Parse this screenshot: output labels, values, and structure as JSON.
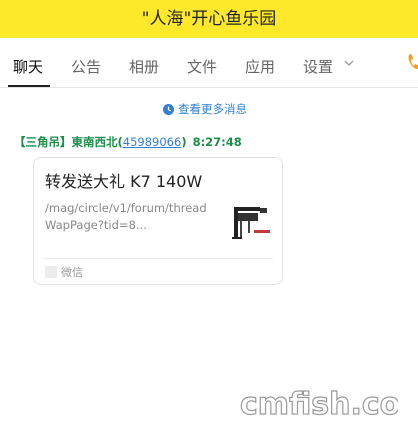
{
  "window": {
    "title": "\"人海\"开心鱼乐园"
  },
  "tabs": [
    {
      "label": "聊天",
      "active": true
    },
    {
      "label": "公告"
    },
    {
      "label": "相册"
    },
    {
      "label": "文件"
    },
    {
      "label": "应用"
    },
    {
      "label": "设置"
    }
  ],
  "messages": {
    "more_history": "查看更多消息",
    "sender_group_tag": "【三角吊】",
    "sender_name": "東南西北",
    "sender_uid": "45989066",
    "sender_time": "8:27:48"
  },
  "card": {
    "title": "转发送大礼 K7 140W",
    "description": "/mag/circle/v1/forum/threadWapPage?tid=8...",
    "source": "微信"
  },
  "watermark": {
    "text": "cmfish.com"
  },
  "colors": {
    "title_bar": "#fde82a",
    "link_blue": "#2f7fd8",
    "sender_green": "#1c8d4a",
    "phone_orange": "#f0a020"
  },
  "icons": {
    "settings_dropdown": "chevron-down-icon",
    "call": "phone-icon",
    "more_history": "history-icon",
    "source": "wechat-icon"
  }
}
